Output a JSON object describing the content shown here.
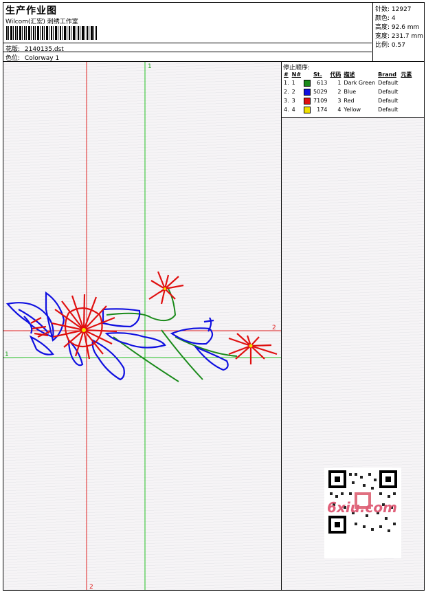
{
  "header": {
    "title": "生产作业图",
    "subtitle": "Wilcom(汇宏) 刺绣工作室",
    "design_label": "花版:",
    "design_value": "2140135.dst",
    "colorway_label": "色位:",
    "colorway_value": "Colorway 1"
  },
  "stats": {
    "stitches": "针数: 12927",
    "colors": "颜色: 4",
    "height": "高度: 92.6 mm",
    "width": "宽度: 231.7 mm",
    "scale": "比例: 0.57"
  },
  "stop_sequence": {
    "title": "停止顺序:",
    "columns": [
      "#",
      "N#",
      "St.",
      "代码",
      "描述",
      "Brand",
      "元素"
    ],
    "rows": [
      {
        "idx": "1.",
        "n": "1",
        "color": "#1a8a1a",
        "st": "613",
        "code": "1",
        "desc": "Dark Green",
        "brand": "Default"
      },
      {
        "idx": "2.",
        "n": "2",
        "color": "#1010e0",
        "st": "5029",
        "code": "2",
        "desc": "Blue",
        "brand": "Default"
      },
      {
        "idx": "3.",
        "n": "3",
        "color": "#e01010",
        "st": "7109",
        "code": "3",
        "desc": "Red",
        "brand": "Default"
      },
      {
        "idx": "4.",
        "n": "4",
        "color": "#f0e000",
        "st": "174",
        "code": "4",
        "desc": "Yellow",
        "brand": "Default"
      }
    ]
  },
  "axes": {
    "v1_top": "1",
    "v2_bottom": "2",
    "h1_left": "1",
    "h2_right": "2"
  },
  "watermark": {
    "logo_text": "6xiu.com"
  }
}
